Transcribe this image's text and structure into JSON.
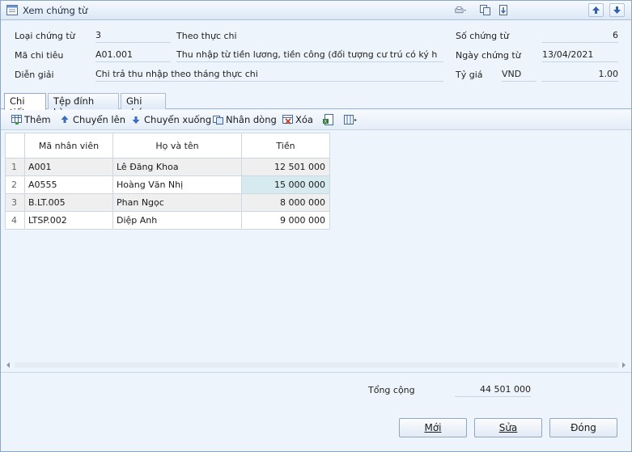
{
  "window": {
    "title": "Xem chứng từ",
    "icons": [
      "document-icon",
      "print-icon",
      "copy-icon",
      "export-icon",
      "prev-record-icon",
      "next-record-icon"
    ]
  },
  "header": {
    "voucher_type_label": "Loại chứng từ",
    "voucher_type_value": "3",
    "voucher_type_desc": "Theo thực chi",
    "voucher_no_label": "Số chứng từ",
    "voucher_no_value": "6",
    "spend_code_label": "Mã chi tiêu",
    "spend_code_value": "A01.001",
    "spend_code_desc": "Thu nhập từ tiền lương, tiền công (đối tượng cư trú có ký h",
    "voucher_date_label": "Ngày chứng từ",
    "voucher_date_value": "13/04/2021",
    "description_label": "Diễn giải",
    "description_value": "Chi trả thu nhập theo tháng thực chi",
    "rate_label": "Tỷ giá",
    "currency_value": "VND",
    "rate_value": "1.00"
  },
  "tabs": [
    "Chi tiết",
    "Tệp đính kèm",
    "Ghi chú"
  ],
  "toolbar": {
    "add": "Thêm",
    "move_up": "Chuyển lên",
    "move_down": "Chuyển xuống",
    "duplicate": "Nhân dòng",
    "delete": "Xóa"
  },
  "grid": {
    "columns": [
      "Mã nhân viên",
      "Họ và tên",
      "Tiền"
    ],
    "rows": [
      {
        "no": "1",
        "code": "A001",
        "name": "Lê Đăng Khoa",
        "amount": "12 501 000"
      },
      {
        "no": "2",
        "code": "A0555",
        "name": "Hoàng  Văn Nhị",
        "amount": "15 000 000"
      },
      {
        "no": "3",
        "code": "B.LT.005",
        "name": "Phan Ngọc",
        "amount": "8 000 000"
      },
      {
        "no": "4",
        "code": "LTSP.002",
        "name": "Diệp Anh",
        "amount": "9 000 000"
      }
    ]
  },
  "footer": {
    "total_label": "Tổng cộng",
    "total_value": "44 501 000",
    "new_button": "Mới",
    "edit_button": "Sửa",
    "close_button": "Đóng"
  }
}
